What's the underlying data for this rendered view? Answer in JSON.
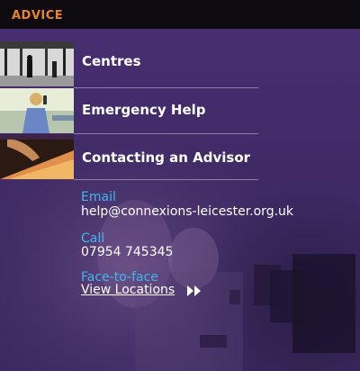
{
  "header": {
    "title": "ADVICE"
  },
  "nav": {
    "items": [
      {
        "label": "Centres"
      },
      {
        "label": "Emergency Help"
      },
      {
        "label": "Contacting an Advisor"
      }
    ]
  },
  "contact": {
    "email_label": "Email",
    "email_value": "help@connexions-leicester.org.uk",
    "call_label": "Call",
    "call_value": "07954 745345",
    "face_label": "Face-to-face",
    "view_link": "View Locations"
  },
  "colors": {
    "accent_orange": "#e9842a",
    "label_blue": "#3fb7f0",
    "panel_purple": "#4a2f73"
  },
  "icons": {
    "view_link_arrows": "double-chevron-right-icon"
  }
}
